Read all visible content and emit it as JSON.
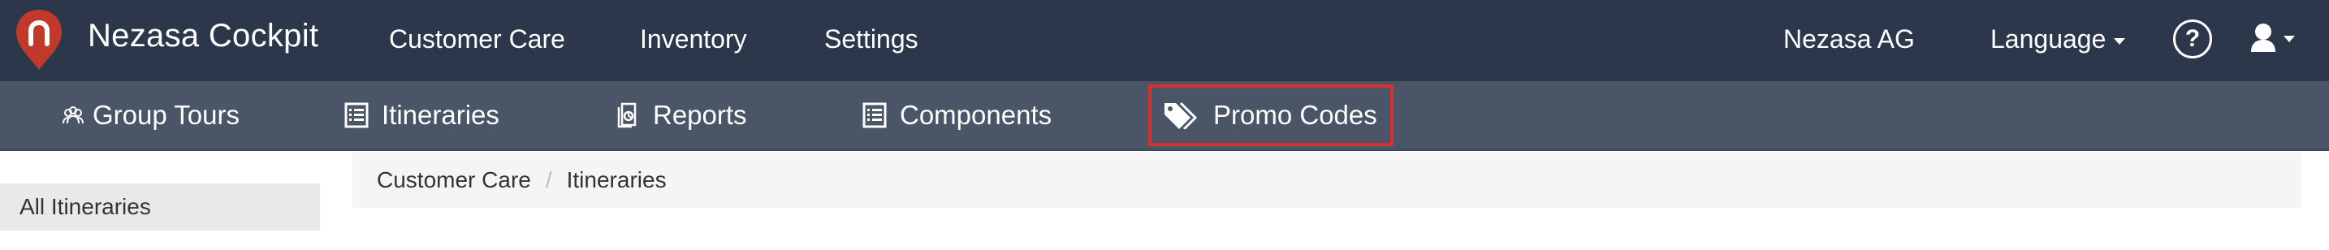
{
  "app": {
    "title": "Nezasa Cockpit",
    "brand_color": "#c0392b"
  },
  "topnav": {
    "items": [
      "Customer Care",
      "Inventory",
      "Settings"
    ],
    "company": "Nezasa AG",
    "language_label": "Language",
    "help_glyph": "?"
  },
  "subnav": {
    "items": [
      {
        "label": "Group Tours",
        "icon": "group-icon"
      },
      {
        "label": "Itineraries",
        "icon": "list-icon"
      },
      {
        "label": "Reports",
        "icon": "report-icon"
      },
      {
        "label": "Components",
        "icon": "list-icon"
      },
      {
        "label": "Promo Codes",
        "icon": "tags-icon"
      }
    ],
    "highlight_color": "#d9302b"
  },
  "sidebar": {
    "items": [
      "All Itineraries"
    ]
  },
  "breadcrumb": {
    "items": [
      "Customer Care",
      "Itineraries"
    ],
    "separator": "/"
  }
}
